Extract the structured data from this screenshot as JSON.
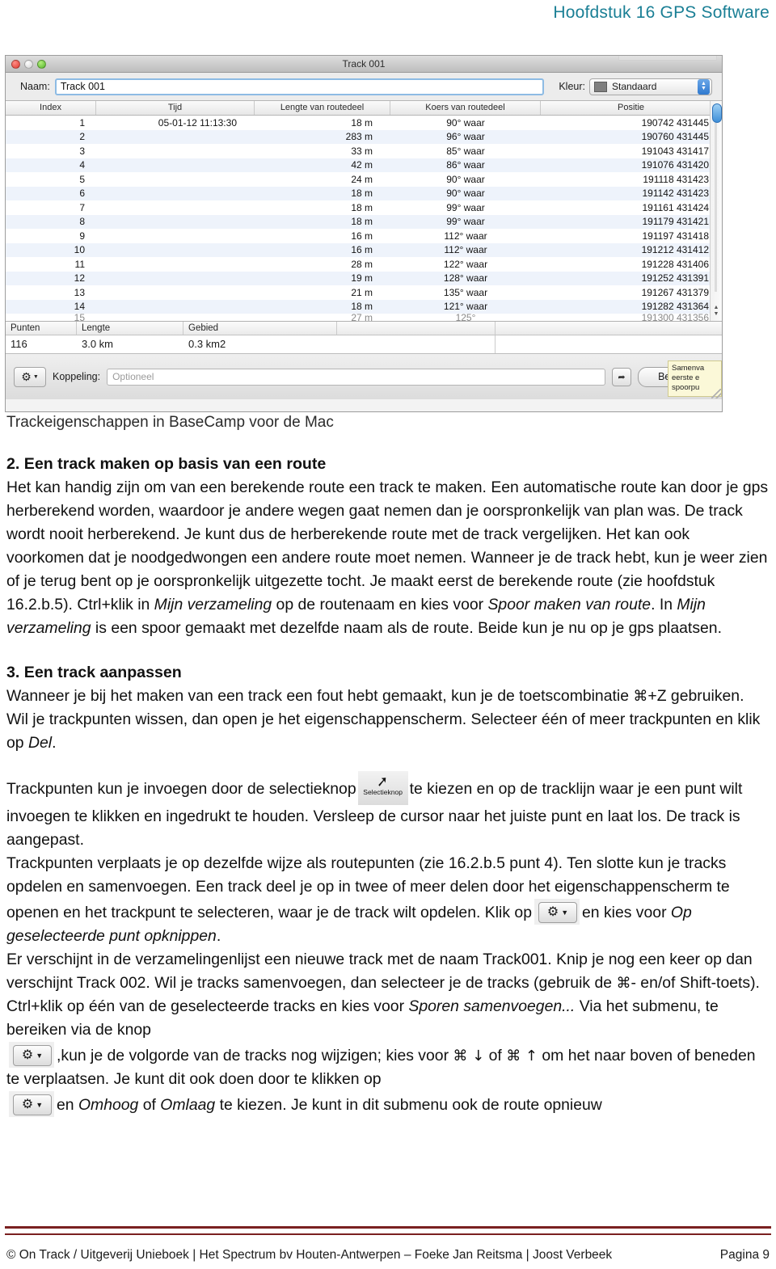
{
  "header": {
    "running_title": "Hoofdstuk 16 GPS Software",
    "color": "#1a7f95"
  },
  "screenshot": {
    "window_title": "Track 001",
    "name_label": "Naam:",
    "name_value": "Track 001",
    "kleur_label": "Kleur:",
    "kleur_value": "Standaard",
    "kleur_swatch": "#7f7f7f",
    "columns": [
      "Index",
      "Tijd",
      "Lengte van routedeel",
      "Koers van routedeel",
      "Positie"
    ],
    "rows": [
      {
        "index": "1",
        "tijd": "05-01-12 11:13:30",
        "lengte": "18 m",
        "koers": "90° waar",
        "positie": "190742 431445"
      },
      {
        "index": "2",
        "tijd": "",
        "lengte": "283 m",
        "koers": "96° waar",
        "positie": "190760 431445"
      },
      {
        "index": "3",
        "tijd": "",
        "lengte": "33 m",
        "koers": "85° waar",
        "positie": "191043 431417"
      },
      {
        "index": "4",
        "tijd": "",
        "lengte": "42 m",
        "koers": "86° waar",
        "positie": "191076 431420"
      },
      {
        "index": "5",
        "tijd": "",
        "lengte": "24 m",
        "koers": "90° waar",
        "positie": "191118 431423"
      },
      {
        "index": "6",
        "tijd": "",
        "lengte": "18 m",
        "koers": "90° waar",
        "positie": "191142 431423"
      },
      {
        "index": "7",
        "tijd": "",
        "lengte": "18 m",
        "koers": "99° waar",
        "positie": "191161 431424"
      },
      {
        "index": "8",
        "tijd": "",
        "lengte": "18 m",
        "koers": "99° waar",
        "positie": "191179 431421"
      },
      {
        "index": "9",
        "tijd": "",
        "lengte": "16 m",
        "koers": "112° waar",
        "positie": "191197 431418"
      },
      {
        "index": "10",
        "tijd": "",
        "lengte": "16 m",
        "koers": "112° waar",
        "positie": "191212 431412"
      },
      {
        "index": "11",
        "tijd": "",
        "lengte": "28 m",
        "koers": "122° waar",
        "positie": "191228 431406"
      },
      {
        "index": "12",
        "tijd": "",
        "lengte": "19 m",
        "koers": "128° waar",
        "positie": "191252 431391"
      },
      {
        "index": "13",
        "tijd": "",
        "lengte": "21 m",
        "koers": "135° waar",
        "positie": "191267 431379"
      },
      {
        "index": "14",
        "tijd": "",
        "lengte": "18 m",
        "koers": "121° waar",
        "positie": "191282 431364"
      },
      {
        "index": "15",
        "tijd": "",
        "lengte": "27 m",
        "koers": "125°",
        "positie": "191300 431356"
      }
    ],
    "summary_headers": [
      "Punten",
      "Lengte",
      "Gebied"
    ],
    "summary_values": [
      "116",
      "3.0 km",
      "0.3 km2"
    ],
    "koppeling_label": "Koppeling:",
    "koppeling_placeholder": "Optioneel",
    "bestand_button": "Bestand",
    "tooltip_lines": [
      "Samenva",
      "eerste e",
      "spoorpu"
    ]
  },
  "caption": "Trackeigenschappen in BaseCamp voor de Mac",
  "sections": {
    "s2_heading": "2. Een track maken op basis van een route",
    "s2_p1_a": "Het kan handig zijn om van een berekende route een track te maken. Een automatische route kan door je gps herberekend worden, waardoor je andere wegen gaat nemen dan je oorspronkelijk van plan was. De track wordt nooit herberekend. Je kunt dus de herberekende route met de track vergelijken. Het kan ook voorkomen dat je noodgedwongen een andere route moet nemen. Wanneer je de track hebt, kun je weer zien of je terug bent op je oorspronkelijk uitgezette tocht. Je maakt eerst de berekende route (zie hoofdstuk 16.2.b.5). Ctrl+klik in ",
    "s2_i1": "Mijn verzameling",
    "s2_p1_b": " op de routenaam en kies voor ",
    "s2_i2": "Spoor maken van route",
    "s2_p1_c": ". In ",
    "s2_i3": "Mijn verzameling",
    "s2_p1_d": " is een spoor gemaakt met dezelfde naam als de route. Beide kun je nu op je gps plaatsen.",
    "s3_heading": "3. Een track aanpassen",
    "s3_p1_a": "Wanneer je bij het maken van een track een fout hebt gemaakt, kun je de toetscombinatie ",
    "s3_cmd": "⌘",
    "s3_p1_b": "+Z gebruiken. Wil je trackpunten wissen, dan open je het eigenschappenscherm. Selecteer één of meer trackpunten en klik op ",
    "s3_i1": "Del",
    "s3_p1_c": ".",
    "p_sel_a": "Trackpunten kun je invoegen door de selectieknop",
    "sel_button_caption": "Selectieknop",
    "p_sel_b": "te kiezen en op de tracklijn waar je een punt wilt invoegen te klikken en ingedrukt te houden. Versleep de cursor naar het juiste punt en laat los. De track is aangepast.",
    "p_move": "Trackpunten verplaats je op dezelfde wijze als routepunten (zie 16.2.b.5 punt 4). Ten slotte kun je tracks opdelen en samenvoegen. Een track deel je op in twee of meer delen door het eigenschappenscherm te openen en het trackpunt te selecteren, waar je de track wilt opdelen. Klik op",
    "p_split_b": "en kies voor ",
    "p_split_i": "Op geselecteerde punt opknippen",
    "p_split_c": ".",
    "p_new_a": "Er verschijnt in de verzamelingenlijst een nieuwe track met de naam Track001. Knip je nog een keer op dan verschijnt Track 002. Wil je tracks samenvoegen, dan selecteer je de tracks (gebruik de ",
    "p_new_cmd": "⌘",
    "p_new_b": "- en/of Shift-toets). Ctrl+klik op één van de geselecteerde tracks en kies voor ",
    "p_new_i": "Sporen samenvoegen...",
    "p_new_c": " Via het submenu, te bereiken via de knop",
    "p_order_a": ",kun je de volgorde van de tracks nog wijzigen; kies voor ",
    "p_order_cmd1": "⌘ ↓",
    "p_order_mid": " of ",
    "p_order_cmd2": "⌘ ↑",
    "p_order_b": " om het naar boven of beneden te verplaatsen. Je kunt dit ook doen door te klikken op",
    "p_last_a": "en ",
    "p_last_i1": "Omhoog",
    "p_last_mid": " of ",
    "p_last_i2": "Omlaag",
    "p_last_b": " te kiezen. Je kunt in dit submenu ook de route opnieuw"
  },
  "footer": {
    "credits": "© On Track / Uitgeverij Unieboek | Het Spectrum bv Houten-Antwerpen – Foeke Jan Reitsma | Joost Verbeek",
    "page": "Pagina 9",
    "rule_color": "#7a2020"
  }
}
